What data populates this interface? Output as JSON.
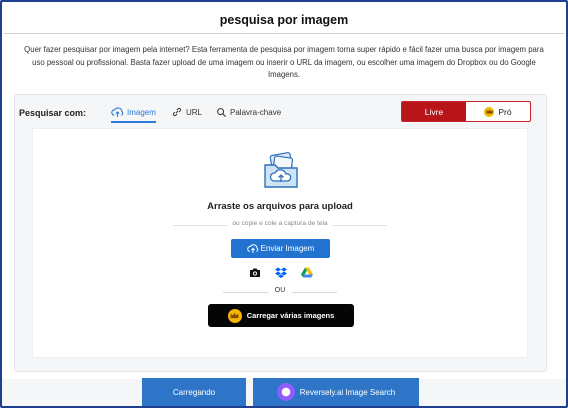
{
  "page": {
    "title": "pesquisa por imagem",
    "description": "Quer fazer pesquisar por imagem pela internet? Esta ferramenta de pesquisa por imagem torna super rápido e fácil fazer uma busca por imagem para uso pessoal ou profissional. Basta fazer upload de uma imagem ou inserir o URL da imagem, ou escolher uma imagem do Dropbox ou do Google Imagens."
  },
  "search": {
    "label": "Pesquisar com:",
    "tabs": [
      {
        "label": "Imagem",
        "icon": "cloud-upload-icon",
        "active": true
      },
      {
        "label": "URL",
        "icon": "link-icon",
        "active": false
      },
      {
        "label": "Palavra-chave",
        "icon": "search-icon",
        "active": false
      }
    ],
    "plans": {
      "free_label": "Livre",
      "pro_label": "Pró",
      "selected": "Livre"
    }
  },
  "upload": {
    "drag_text": "Arraste os arquivos para upload",
    "paste_text": "ou copie e cole a captura de tela",
    "upload_button": "Enviar Imagem",
    "sources": [
      "camera-icon",
      "dropbox-icon",
      "google-drive-icon"
    ],
    "or_text": "OU",
    "multi_button": "Carregar várias imagens"
  },
  "footer": {
    "loading_button": "Carregando",
    "reversely_button": "Reversely.ai Image Search"
  },
  "colors": {
    "accent": "#2273d0",
    "plan_free": "#b8151b",
    "pro_crown": "#f5b400",
    "frame": "#1f3f8f"
  }
}
